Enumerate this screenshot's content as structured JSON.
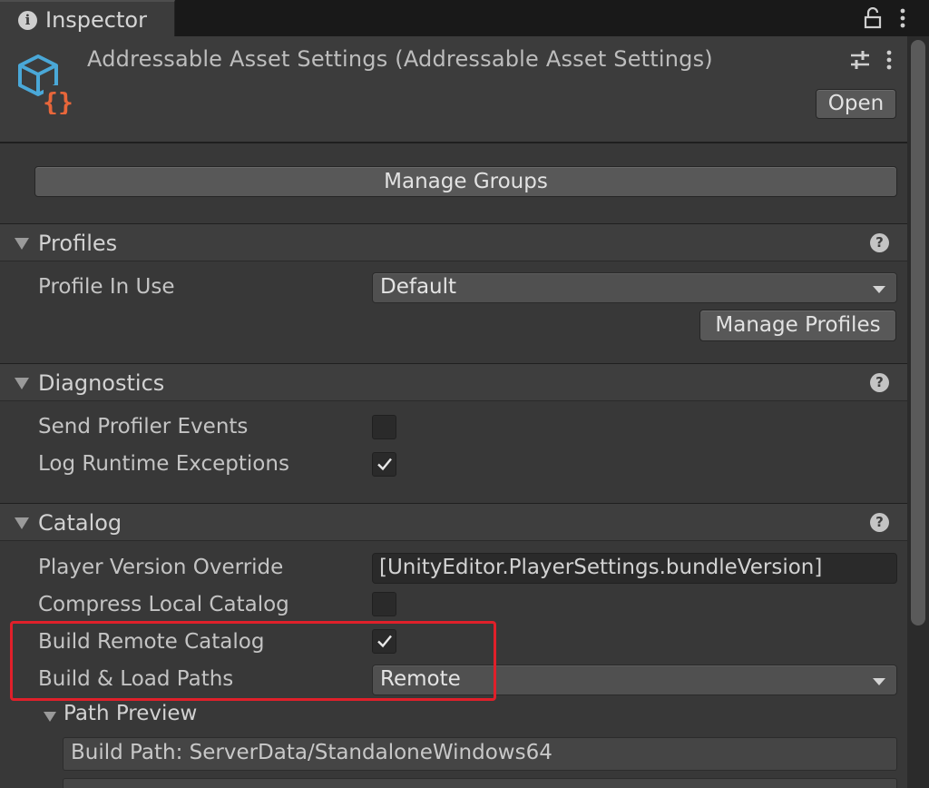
{
  "tab": {
    "title": "Inspector",
    "info_icon": "info-icon",
    "lock_icon": "lock-icon",
    "menu_icon": "kebab-menu-icon"
  },
  "header": {
    "title": "Addressable Asset Settings (Addressable Asset Settings)",
    "icon": "addressables-cube-icon",
    "open_label": "Open",
    "accent_color": "#4aa8d8",
    "brace_color": "#e8663a"
  },
  "manage_groups_label": "Manage Groups",
  "profiles": {
    "title": "Profiles",
    "help": "?",
    "profile_in_use_label": "Profile In Use",
    "profile_in_use_value": "Default",
    "manage_profiles_label": "Manage Profiles"
  },
  "diagnostics": {
    "title": "Diagnostics",
    "help": "?",
    "send_profiler_events_label": "Send Profiler Events",
    "send_profiler_events_checked": false,
    "log_runtime_exceptions_label": "Log Runtime Exceptions",
    "log_runtime_exceptions_checked": true
  },
  "catalog": {
    "title": "Catalog",
    "help": "?",
    "player_version_override_label": "Player Version Override",
    "player_version_override_value": "[UnityEditor.PlayerSettings.bundleVersion]",
    "compress_local_catalog_label": "Compress Local Catalog",
    "compress_local_catalog_checked": false,
    "build_remote_catalog_label": "Build Remote Catalog",
    "build_remote_catalog_checked": true,
    "build_load_paths_label": "Build & Load Paths",
    "build_load_paths_value": "Remote",
    "path_preview": {
      "title": "Path Preview",
      "build_path": "Build Path: ServerData/StandaloneWindows64"
    }
  },
  "highlight_color": "#e0202a"
}
